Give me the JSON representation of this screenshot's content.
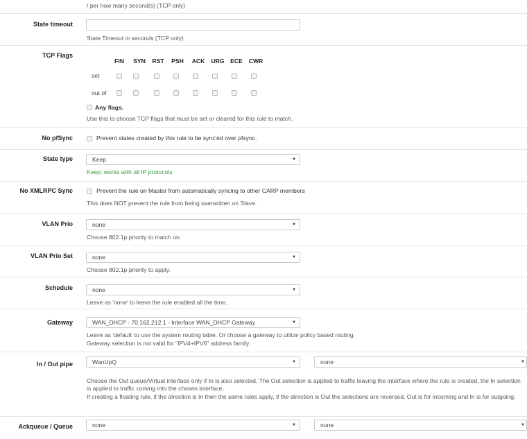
{
  "top_help": "/ per how many second(s) (TCP only)",
  "state_timeout": {
    "label": "State timeout",
    "value": "",
    "help": "State Timeout in seconds (TCP only)"
  },
  "tcp_flags": {
    "label": "TCP Flags",
    "flags": [
      "FIN",
      "SYN",
      "RST",
      "PSH",
      "ACK",
      "URG",
      "ECE",
      "CWR"
    ],
    "set_label": "set",
    "outof_label": "out of",
    "any_flags_label": "Any flags.",
    "help": "Use this to choose TCP flags that must be set or cleared for this rule to match."
  },
  "no_pfsync": {
    "label": "No pfSync",
    "text": "Prevent states created by this rule to be sync'ed over pfsync."
  },
  "state_type": {
    "label": "State type",
    "value": "Keep",
    "help": "Keep: works with all IP protocols"
  },
  "no_xmlrpc": {
    "label": "No XMLRPC Sync",
    "text": "Prevent the rule on Master from automatically syncing to other CARP members",
    "help": "This does NOT prevent the rule from being overwritten on Slave."
  },
  "vlan_prio": {
    "label": "VLAN Prio",
    "value": "none",
    "help": "Choose 802.1p priority to match on."
  },
  "vlan_prio_set": {
    "label": "VLAN Prio Set",
    "value": "none",
    "help": "Choose 802.1p priority to apply."
  },
  "schedule": {
    "label": "Schedule",
    "value": "none",
    "help": "Leave as 'none' to leave the rule enabled all the time."
  },
  "gateway": {
    "label": "Gateway",
    "value": "WAN_DHCP - 70.162.212.1 - Interface WAN_DHCP Gateway",
    "help1": "Leave as 'default' to use the system routing table. Or choose a gateway to utilize policy based routing.",
    "help2": "Gateway selection is not valid for \"IPV4+IPV6\" address family."
  },
  "inout_pipe": {
    "label": "In / Out pipe",
    "in_value": "WanUpQ",
    "out_value": "none",
    "help1": "Choose the Out queue/Virtual interface only if In is also selected. The Out selection is applied to traffic leaving the interface where the rule is created, the In selection is applied to traffic coming into the chosen interface.",
    "help2": "If creating a floating rule, if the direction is In then the same rules apply, if the direction is Out the selections are reversed, Out is for incoming and In is for outgoing."
  },
  "ackqueue": {
    "label": "Ackqueue / Queue",
    "ack_value": "none",
    "queue_value": "none"
  }
}
